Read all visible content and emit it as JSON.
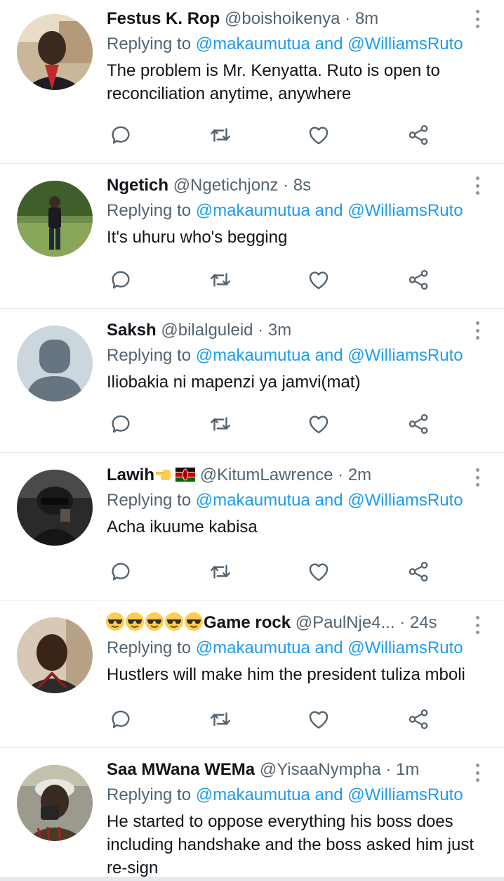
{
  "tweets": [
    {
      "name": "Festus K. Rop",
      "handle": "@boishoikenya",
      "dot": "·",
      "time": "8m",
      "replying_prefix": "Replying to",
      "replying_link": "@makaumutua and @WilliamsRuto",
      "text": "The problem is Mr. Kenyatta. Ruto is open to reconciliation anytime, anywhere"
    },
    {
      "name": "Ngetich",
      "handle": "@Ngetichjonz",
      "dot": "·",
      "time": "8s",
      "replying_prefix": "Replying to",
      "replying_link": "@makaumutua and @WilliamsRuto",
      "text": "It's uhuru who's begging"
    },
    {
      "name": "Saksh",
      "handle": "@bilalguleid",
      "dot": "·",
      "time": "3m",
      "replying_prefix": "Replying to",
      "replying_link": "@makaumutua and @WilliamsRuto",
      "text": "Iliobakia ni mapenzi ya jamvi(mat)"
    },
    {
      "name": "Lawih",
      "handle": "@KitumLawrence",
      "dot": "·",
      "time": "2m",
      "replying_prefix": "Replying to",
      "replying_link": "@makaumutua and @WilliamsRuto",
      "text": "Acha ikuume kabisa"
    },
    {
      "name": "Game rock",
      "handle": "@PaulNje4...",
      "dot": "·",
      "time": "24s",
      "replying_prefix": "Replying to",
      "replying_link": "@makaumutua and @WilliamsRuto",
      "text": "Hustlers will make him the president tuliza mboli"
    },
    {
      "name": "Saa MWana WEMa",
      "handle": "@YisaaNympha",
      "dot": "·",
      "time": "1m",
      "replying_prefix": "Replying to",
      "replying_link": "@makaumutua and @WilliamsRuto",
      "text": "He started to oppose everything his boss does including handshake and the boss asked him just re-sign"
    }
  ],
  "icons": {
    "reply": "reply-icon",
    "retweet": "retweet-icon",
    "like": "heart-icon",
    "share": "share-icon",
    "more": "more-vertical-icon"
  },
  "colors": {
    "link": "#1d9bf0",
    "secondary": "#536471",
    "primary_text": "#0f1419",
    "divider": "#e3e6e8"
  }
}
